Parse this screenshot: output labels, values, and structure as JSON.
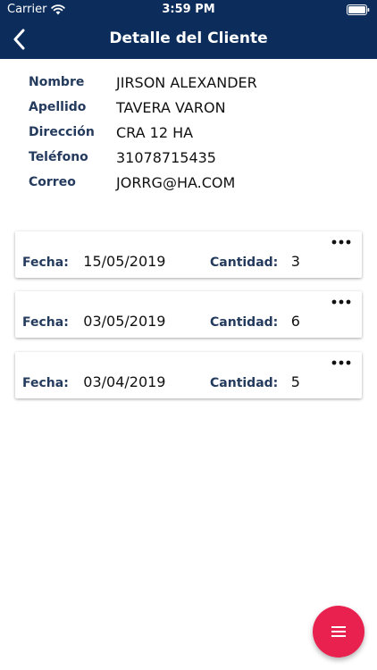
{
  "status_bar": {
    "carrier": "Carrier",
    "time": "3:59 PM"
  },
  "header": {
    "title": "Detalle del Cliente",
    "back_icon": "chevron-left-icon"
  },
  "client": {
    "fields": [
      {
        "label": "Nombre",
        "value": "JIRSON ALEXANDER"
      },
      {
        "label": "Apellido",
        "value": "TAVERA VARON"
      },
      {
        "label": "Dirección",
        "value": "CRA 12 HA"
      },
      {
        "label": "Teléfono",
        "value": "31078715435"
      },
      {
        "label": "Correo",
        "value": "JORRG@HA.COM"
      }
    ]
  },
  "orders": [
    {
      "fecha_label": "Fecha:",
      "fecha": "15/05/2019",
      "cantidad_label": "Cantidad:",
      "cantidad": "3"
    },
    {
      "fecha_label": "Fecha:",
      "fecha": "03/05/2019",
      "cantidad_label": "Cantidad:",
      "cantidad": "6"
    },
    {
      "fecha_label": "Fecha:",
      "fecha": "03/04/2019",
      "cantidad_label": "Cantidad:",
      "cantidad": "5"
    }
  ],
  "fab": {
    "icon": "menu-icon"
  },
  "colors": {
    "header": "#0c2d5c",
    "label": "#243b5e",
    "fab": "#e9214f"
  }
}
